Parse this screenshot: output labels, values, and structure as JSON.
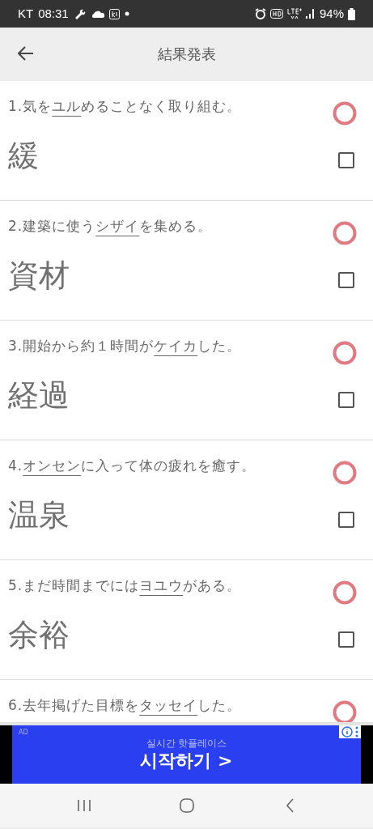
{
  "status_bar": {
    "carrier": "KT",
    "time": "08:31",
    "battery": "94%"
  },
  "header": {
    "title": "結果発表"
  },
  "questions": [
    {
      "number": "1.",
      "before": "気を",
      "target": "ユル",
      "after": "めることなく取り組む。",
      "correct": true,
      "answer": "緩",
      "checked": false
    },
    {
      "number": "2.",
      "before": "建築に使う",
      "target": "シザイ",
      "after": "を集める。",
      "correct": true,
      "answer": "資材",
      "checked": false
    },
    {
      "number": "3.",
      "before": "開始から約１時間が",
      "target": "ケイカ",
      "after": "した。",
      "correct": true,
      "answer": "経過",
      "checked": false
    },
    {
      "number": "4.",
      "target": "オンセン",
      "after": "に入って体の疲れを癒す。",
      "correct": true,
      "answer": "温泉",
      "checked": false
    },
    {
      "number": "5.",
      "before": "まだ時間までには",
      "target": "ヨユウ",
      "after": "がある。",
      "correct": true,
      "answer": "余裕",
      "checked": false
    },
    {
      "number": "6.",
      "before": "去年掲げた目標を",
      "target": "タッセイ",
      "after": "した。",
      "correct": true
    }
  ],
  "ad": {
    "label": "AD",
    "subtitle": "실시간 핫플레이스",
    "headline": "시작하기 >"
  }
}
